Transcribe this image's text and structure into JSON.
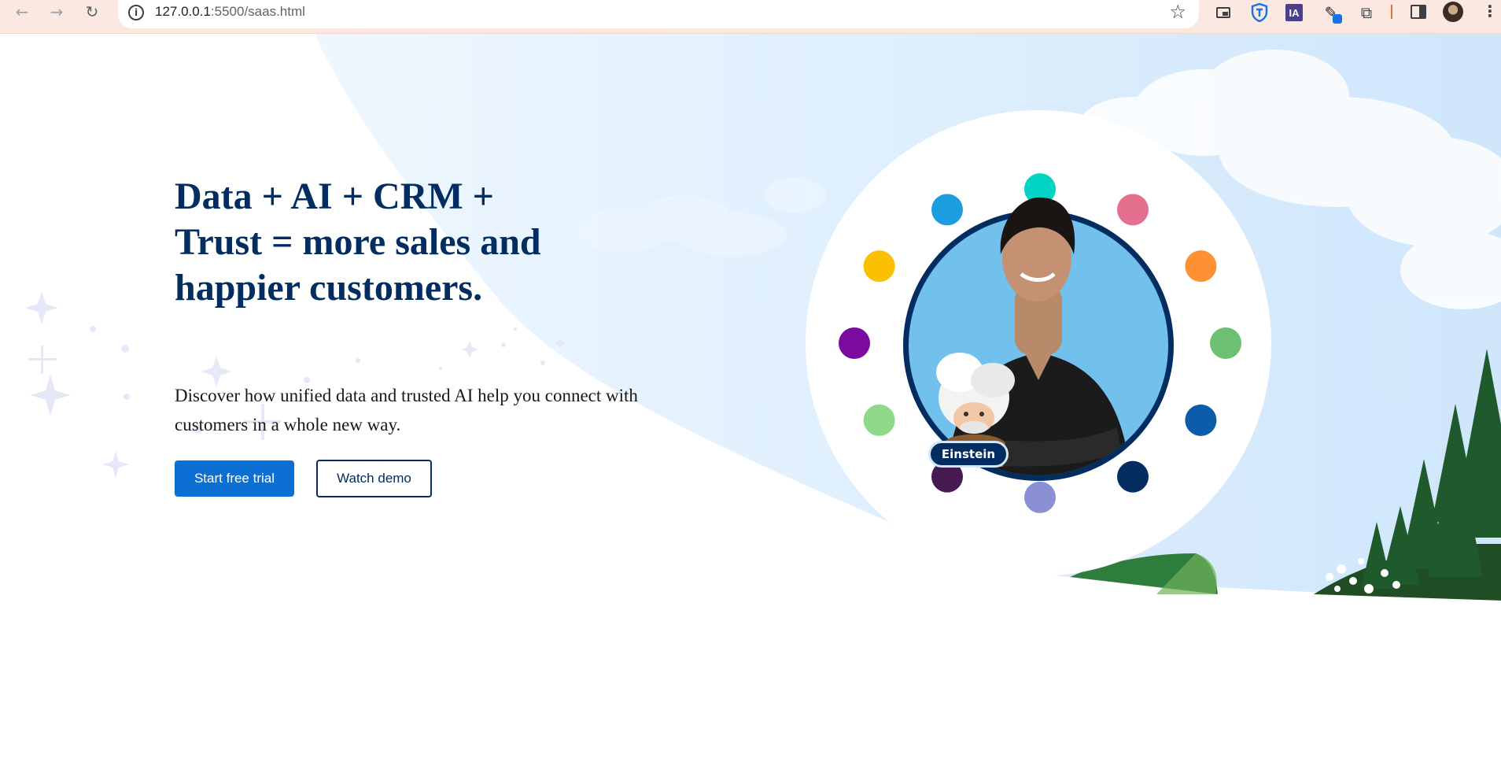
{
  "browser": {
    "url_host": "127.0.0.1",
    "url_path": ":5500/saas.html",
    "icons": [
      "back-icon",
      "forward-icon",
      "reload-icon",
      "site-info-icon",
      "bookmark-star-icon",
      "picture-in-picture-icon",
      "shield-extension-icon",
      "ia-extension-icon",
      "pen-extension-icon",
      "extensions-puzzle-icon",
      "side-panel-icon",
      "profile-avatar",
      "menu-kebab-icon"
    ],
    "ia_label": "IA"
  },
  "hero": {
    "headline": "Data + AI + CRM + Trust = more sales and happier customers.",
    "subtext": "Discover how unified data and trusted AI help you connect with customers in a whole new way.",
    "primary_cta": "Start free trial",
    "secondary_cta": "Watch demo",
    "einstein_label": "Einstein"
  },
  "colors": {
    "headline": "#032d60",
    "primary_button": "#0b6fd4",
    "sky": "#d6ebfb",
    "ring": "#032d60",
    "portrait_bg": "#72c0ec",
    "dots": [
      "#00d3c4",
      "#e46f8e",
      "#ff9135",
      "#6cbf73",
      "#0b5cab",
      "#032d60",
      "#8b8fd3",
      "#481a54",
      "#8fd98a",
      "#7b0aa0",
      "#fcc003",
      "#1b9ee0"
    ]
  }
}
